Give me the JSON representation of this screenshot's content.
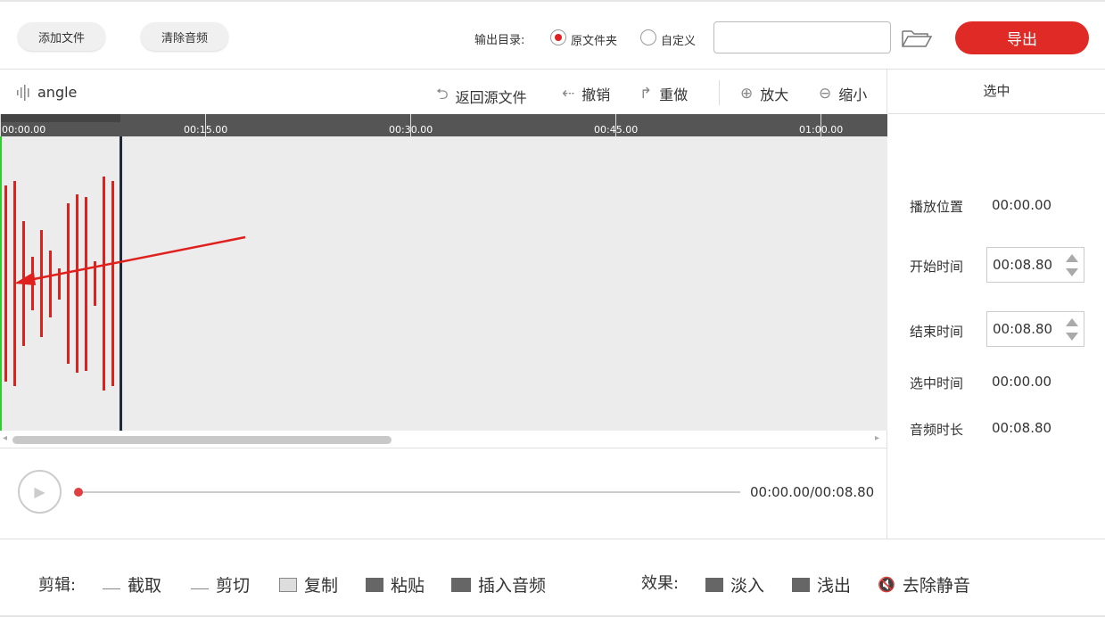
{
  "topbar": {
    "add_file": "添加文件",
    "clear_audio": "清除音频",
    "output_dir_label": "输出目录:",
    "opt_source_folder": "原文件夹",
    "opt_custom": "自定义",
    "dir_value": "",
    "export": "导出"
  },
  "toolbar": {
    "file_name": "angle",
    "back_to_source": "返回源文件",
    "undo": "撤销",
    "redo": "重做",
    "zoom_in": "放大",
    "zoom_out": "缩小"
  },
  "ruler": {
    "ticks": [
      "00:00.00",
      "00:15.00",
      "00:30.00",
      "00:45.00",
      "01:00.00"
    ]
  },
  "player": {
    "time": "00:00.00/00:08.80",
    "progress": 0.0
  },
  "side": {
    "title": "选中",
    "play_pos_label": "播放位置",
    "play_pos_value": "00:00.00",
    "start_label": "开始时间",
    "start_value": "00:08.80",
    "end_label": "结束时间",
    "end_value": "00:08.80",
    "sel_label": "选中时间",
    "sel_value": "00:00.00",
    "dur_label": "音频时长",
    "dur_value": "00:08.80"
  },
  "bottom": {
    "edit_label": "剪辑:",
    "trim": "截取",
    "cut": "剪切",
    "copy": "复制",
    "paste": "粘贴",
    "insert_audio": "插入音频",
    "effects_label": "效果:",
    "fade_in": "淡入",
    "fade_out": "浅出",
    "remove_silence": "去除静音"
  },
  "colors": {
    "accent": "#e02a26",
    "waveform": "#e0201c",
    "start_marker": "#33cc33"
  }
}
